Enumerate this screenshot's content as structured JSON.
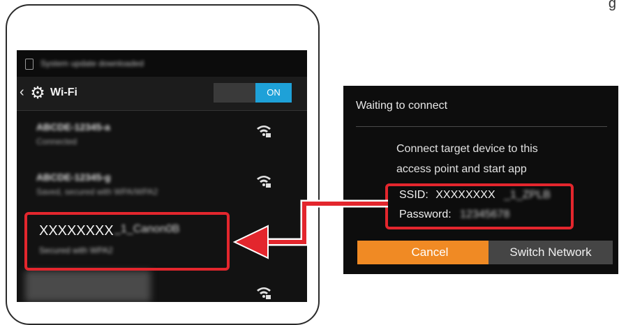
{
  "phone": {
    "status_text": "System update downloaded",
    "wifi_title": "Wi-Fi",
    "toggle_label": "ON",
    "networks": [
      {
        "name": "ABCDE-12345-a",
        "sub": "Connected"
      },
      {
        "name": "ABCDE-12345-g",
        "sub": "Saved, secured with WPA/WPA2"
      }
    ],
    "highlighted": {
      "ssid": "XXXXXXXX",
      "ssid_suffix": "_1_Canon0B",
      "sub": "Secured with WPA2"
    }
  },
  "dialog": {
    "title": "Waiting to connect",
    "message_line1": "Connect target device to this",
    "message_line2": "access point and start app",
    "ssid_label": "SSID:",
    "ssid_value": "XXXXXXXX",
    "ssid_suffix": "_1_ZPLB",
    "password_label": "Password:",
    "password_value": "12345678",
    "cancel_label": "Cancel",
    "switch_label": "Switch Network"
  },
  "colors": {
    "highlight_red": "#e3262d",
    "toggle_blue": "#1ea1d8",
    "cancel_orange": "#f08a24"
  }
}
